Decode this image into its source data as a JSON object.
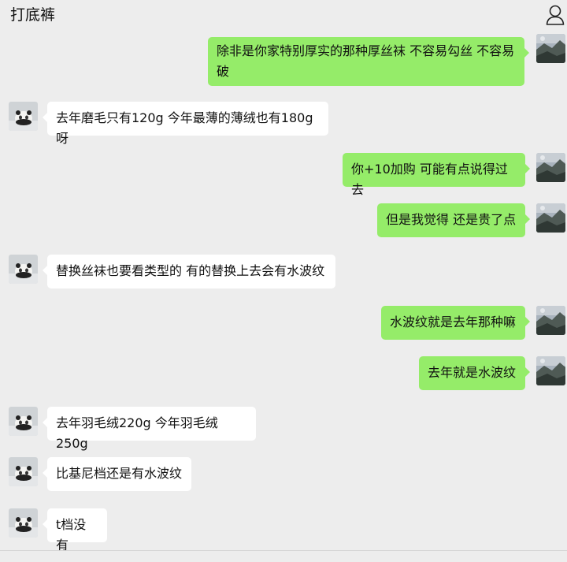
{
  "header": {
    "title": "打底裤",
    "profile_icon": "person-outline-icon"
  },
  "messages": [
    {
      "side": "right",
      "text": "除非是你家特别厚实的那种厚丝袜 不容易勾丝 不容易破"
    },
    {
      "side": "left",
      "text": "去年磨毛只有120g 今年最薄的薄绒也有180g呀"
    },
    {
      "side": "right",
      "text": "你+10加购 可能有点说得过去"
    },
    {
      "side": "right",
      "text": "但是我觉得 还是贵了点"
    },
    {
      "side": "left",
      "text": "替换丝袜也要看类型的 有的替换上去会有水波纹"
    },
    {
      "side": "right",
      "text": "水波纹就是去年那种嘛"
    },
    {
      "side": "right",
      "text": "去年就是水波纹"
    },
    {
      "side": "left",
      "text": "去年羽毛绒220g 今年羽毛绒250g"
    },
    {
      "side": "left",
      "text": "比基尼档还是有水波纹"
    },
    {
      "side": "left",
      "text": "t档没有"
    }
  ],
  "colors": {
    "background": "#ededed",
    "sent_bubble": "#95ec69",
    "received_bubble": "#ffffff"
  }
}
